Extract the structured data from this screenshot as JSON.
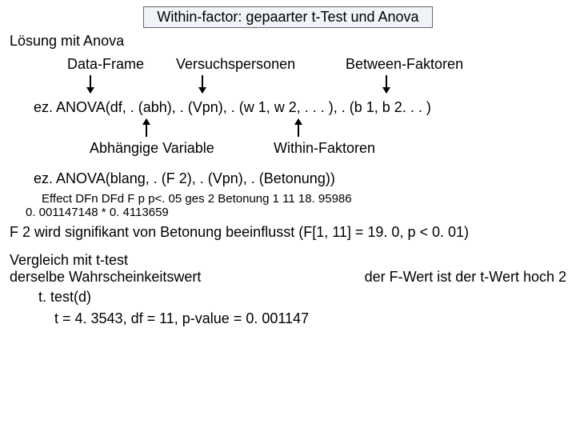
{
  "title": "Within-factor: gepaarter t-Test und Anova",
  "subtitle": "Lösung mit Anova",
  "labels_top": {
    "data_frame": "Data-Frame",
    "subjects": "Versuchspersonen",
    "between": "Between-Faktoren"
  },
  "anova_generic": "ez. ANOVA(df, . (abh), . (Vpn), . (w 1, w 2, . . . ), . (b 1, b 2. . . )",
  "labels_bottom": {
    "dep_var": "Abhängige Variable",
    "within": "Within-Faktoren"
  },
  "anova_example": "ez. ANOVA(blang, . (F 2), . (Vpn), . (Betonung))",
  "stats_header": "Effect DFn DFd        F          p p<. 05       ges 2 Betonung   1  11 18. 95986",
  "stats_values": "0. 001147148      * 0. 4113659",
  "conclusion": "F 2 wird signifikant von Betonung beeinflusst (F[1, 11] = 19. 0, p < 0. 01)",
  "ttest_left1": "Vergleich mit t-test",
  "ttest_left2": "derselbe Wahrscheinkeitswert",
  "ttest_right": "der F-Wert ist der t-Wert hoch 2",
  "ttest_call": "t. test(d)",
  "ttest_output": "t = 4. 3543, df = 11, p-value = 0. 001147"
}
